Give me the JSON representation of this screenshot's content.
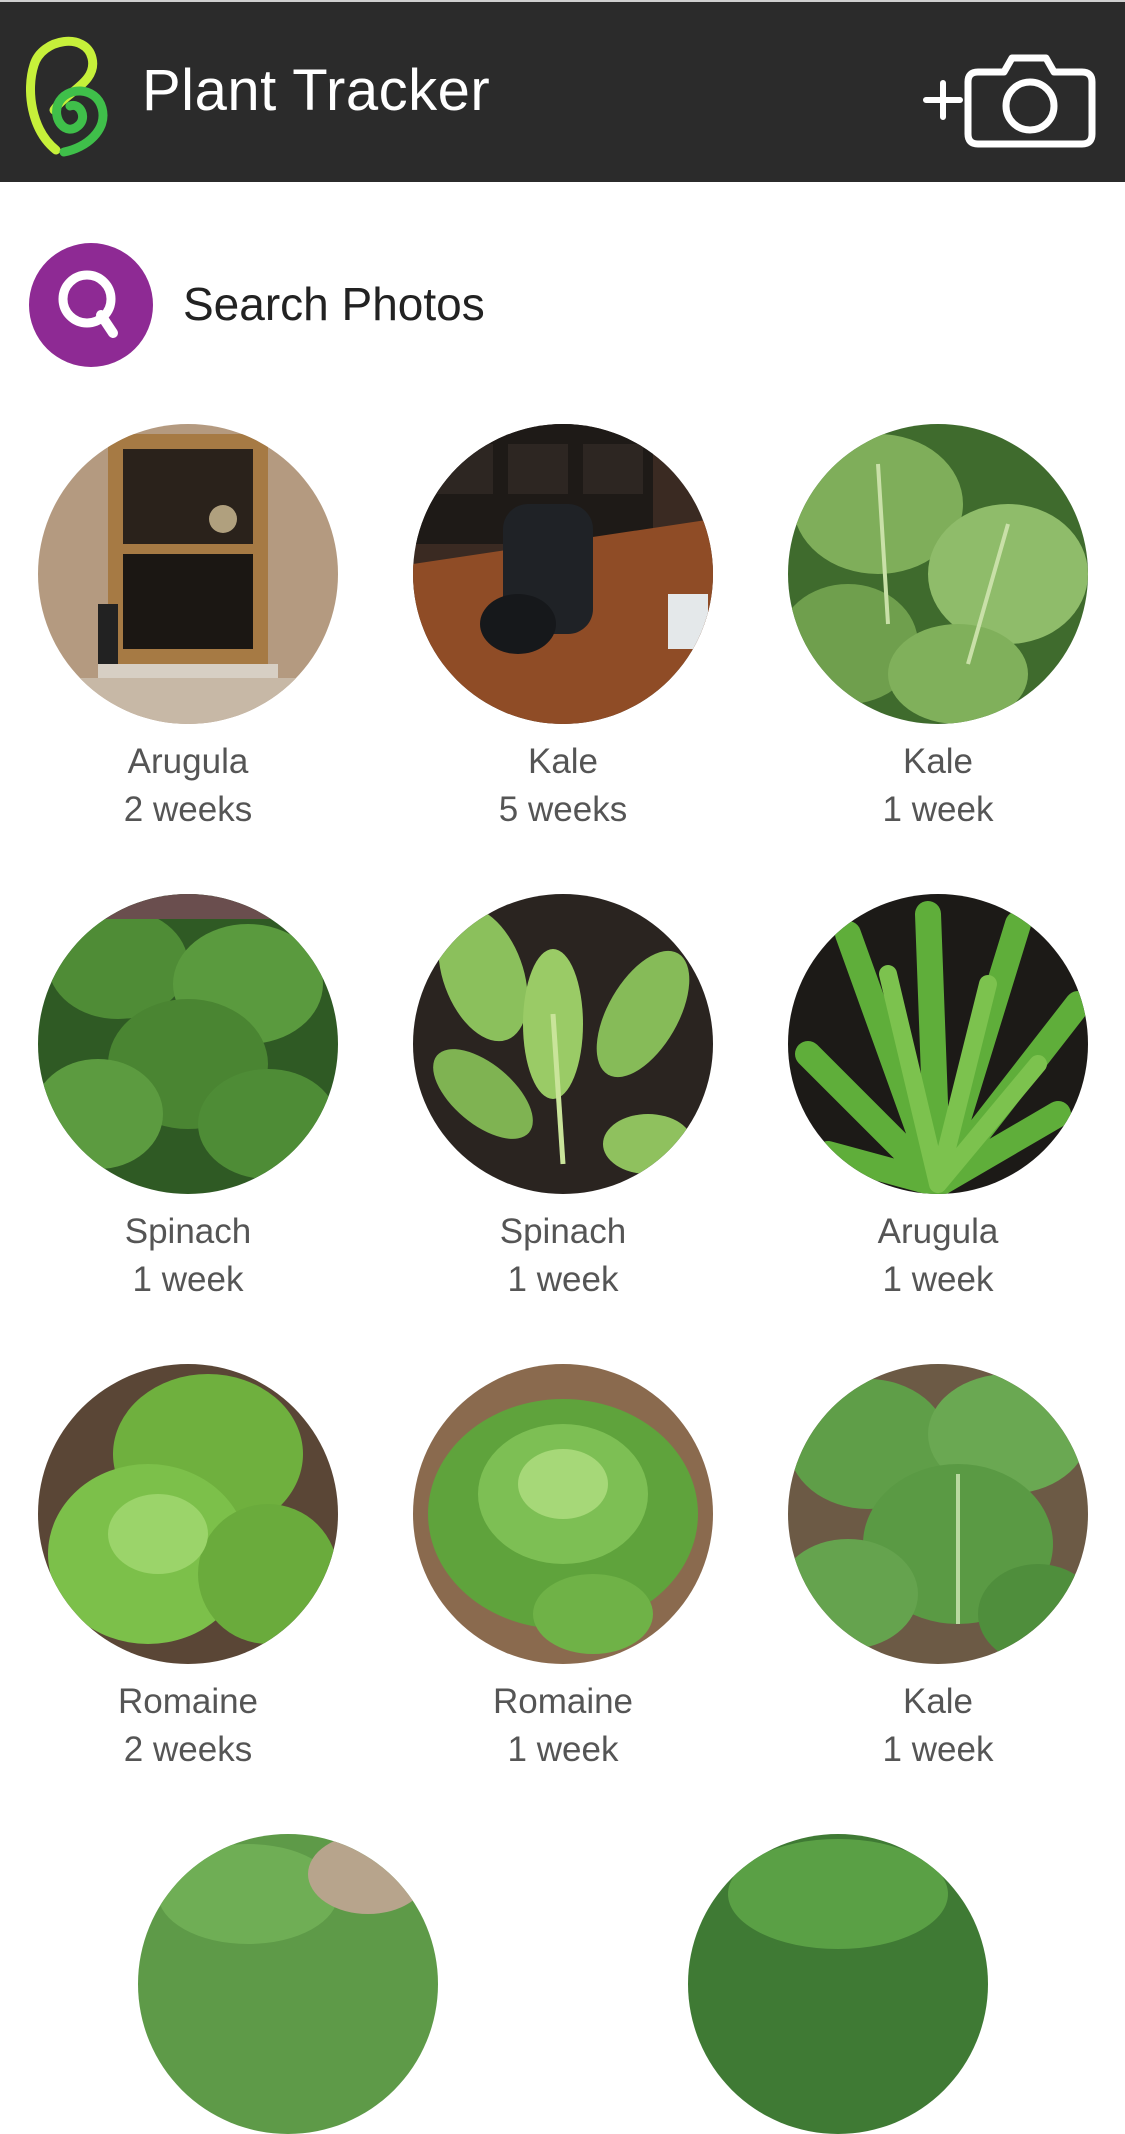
{
  "header": {
    "title": "Plant Tracker",
    "logo_icon": "sprout-logo-icon",
    "add_photo_icon": "add-camera-icon",
    "background": "#2b2b2b",
    "logo_colors": [
      "#c6f03a",
      "#3fbf4a"
    ]
  },
  "search": {
    "label": "Search Photos",
    "icon": "search-icon",
    "accent": "#8e2a94"
  },
  "plants": [
    {
      "name": "Arugula",
      "age": "2 weeks",
      "photo": "window-indoor-photo"
    },
    {
      "name": "Kale",
      "age": "5 weeks",
      "photo": "jar-on-table-photo"
    },
    {
      "name": "Kale",
      "age": "1 week",
      "photo": "kale-leaves-photo"
    },
    {
      "name": "Spinach",
      "age": "1 week",
      "photo": "spinach-bush-photo"
    },
    {
      "name": "Spinach",
      "age": "1 week",
      "photo": "spinach-seedling-photo"
    },
    {
      "name": "Arugula",
      "age": "1 week",
      "photo": "arugula-photo"
    },
    {
      "name": "Romaine",
      "age": "2 weeks",
      "photo": "romaine-head-photo"
    },
    {
      "name": "Romaine",
      "age": "1 week",
      "photo": "romaine-rosette-photo"
    },
    {
      "name": "Kale",
      "age": "1 week",
      "photo": "collard-leaves-photo"
    }
  ]
}
